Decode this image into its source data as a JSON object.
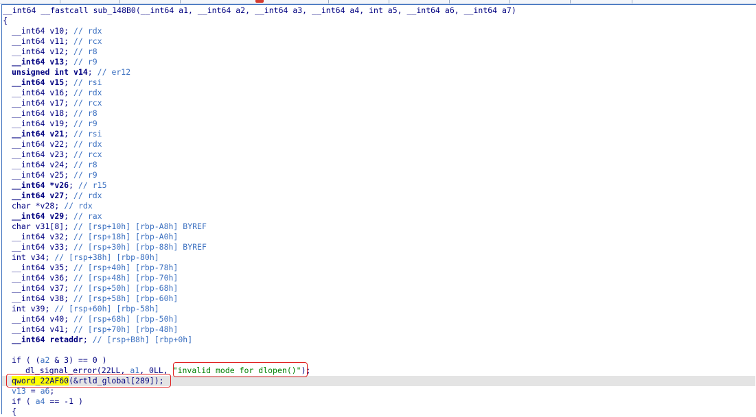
{
  "signature": "__int64 __fastcall sub_148B0(__int64 a1, __int64 a2, __int64 a3, __int64 a4, int a5, __int64 a6, __int64 a7)",
  "open_brace": "{",
  "decls": [
    {
      "type": "__int64 ",
      "name": "v10",
      "comment": "rdx",
      "bold": false
    },
    {
      "type": "__int64 ",
      "name": "v11",
      "comment": "rcx",
      "bold": false
    },
    {
      "type": "__int64 ",
      "name": "v12",
      "comment": "r8",
      "bold": false
    },
    {
      "type": "__int64 ",
      "name": "v13",
      "comment": "r9",
      "bold": true
    },
    {
      "type": "unsigned int ",
      "name": "v14",
      "comment": "er12",
      "bold": true
    },
    {
      "type": "__int64 ",
      "name": "v15",
      "comment": "rsi",
      "bold": true
    },
    {
      "type": "__int64 ",
      "name": "v16",
      "comment": "rdx",
      "bold": false
    },
    {
      "type": "__int64 ",
      "name": "v17",
      "comment": "rcx",
      "bold": false
    },
    {
      "type": "__int64 ",
      "name": "v18",
      "comment": "r8",
      "bold": false
    },
    {
      "type": "__int64 ",
      "name": "v19",
      "comment": "r9",
      "bold": false
    },
    {
      "type": "__int64 ",
      "name": "v21",
      "comment": "rsi",
      "bold": true
    },
    {
      "type": "__int64 ",
      "name": "v22",
      "comment": "rdx",
      "bold": false
    },
    {
      "type": "__int64 ",
      "name": "v23",
      "comment": "rcx",
      "bold": false
    },
    {
      "type": "__int64 ",
      "name": "v24",
      "comment": "r8",
      "bold": false
    },
    {
      "type": "__int64 ",
      "name": "v25",
      "comment": "r9",
      "bold": false
    },
    {
      "type": "__int64 *",
      "name": "v26",
      "comment": "r15",
      "bold": true
    },
    {
      "type": "__int64 ",
      "name": "v27",
      "comment": "rdx",
      "bold": true
    },
    {
      "type": "char *",
      "name": "v28",
      "comment": "rdx",
      "bold": false
    },
    {
      "type": "__int64 ",
      "name": "v29",
      "comment": "rax",
      "bold": true
    },
    {
      "type": "char ",
      "name": "v31[8]",
      "comment": "[rsp+10h] [rbp-A8h] BYREF",
      "bold": false
    },
    {
      "type": "__int64 ",
      "name": "v32",
      "comment": "[rsp+18h] [rbp-A0h]",
      "bold": false
    },
    {
      "type": "__int64 ",
      "name": "v33",
      "comment": "[rsp+30h] [rbp-88h] BYREF",
      "bold": false
    },
    {
      "type": "int ",
      "name": "v34",
      "comment": "[rsp+38h] [rbp-80h]",
      "bold": false
    },
    {
      "type": "__int64 ",
      "name": "v35",
      "comment": "[rsp+40h] [rbp-78h]",
      "bold": false
    },
    {
      "type": "__int64 ",
      "name": "v36",
      "comment": "[rsp+48h] [rbp-70h]",
      "bold": false
    },
    {
      "type": "__int64 ",
      "name": "v37",
      "comment": "[rsp+50h] [rbp-68h]",
      "bold": false
    },
    {
      "type": "__int64 ",
      "name": "v38",
      "comment": "[rsp+58h] [rbp-60h]",
      "bold": false
    },
    {
      "type": "int ",
      "name": "v39",
      "comment": "[rsp+60h] [rbp-58h]",
      "bold": false
    },
    {
      "type": "__int64 ",
      "name": "v40",
      "comment": "[rsp+68h] [rbp-50h]",
      "bold": false
    },
    {
      "type": "__int64 ",
      "name": "v41",
      "comment": "[rsp+70h] [rbp-48h]",
      "bold": false
    },
    {
      "type": "__int64 ",
      "name": "retaddr",
      "comment": "[rsp+B8h] [rbp+0h]",
      "bold": true
    }
  ],
  "body": {
    "if1_pre": "if ( (",
    "if1_a2": "a2",
    "if1_post": " & 3) == 0 )",
    "call_pre": "dl_signal_error(22LL, ",
    "call_a1": "a1",
    "call_mid": ", 0LL, ",
    "call_str": "\"invalid mode for dlopen()\"",
    "call_end": ");",
    "q_pre": "qword_",
    "q_cursor": "2",
    "q_post": "2AF60",
    "q_args": "(&rtld_global[289]);",
    "v13_pre": "v13",
    "v13_post": " = ",
    "v13_a6": "a6",
    "v13_end": ";",
    "if2_pre": "if ( ",
    "if2_a4": "a4",
    "if2_post": " == -1 )",
    "brace2": "{"
  }
}
